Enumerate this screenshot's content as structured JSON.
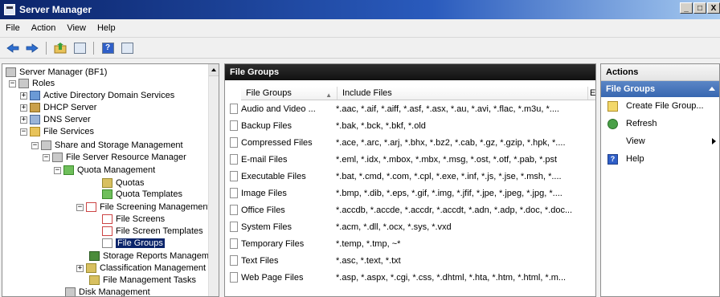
{
  "window": {
    "title": "Server Manager",
    "buttons": [
      "_",
      "□",
      "X"
    ]
  },
  "menu": [
    "File",
    "Action",
    "View",
    "Help"
  ],
  "toolbar": {
    "buttons": [
      "back-arrow-icon",
      "forward-arrow-icon",
      "up-folder-icon",
      "show-hide-tree-icon",
      "help-icon",
      "properties-icon"
    ],
    "help_glyph": "?"
  },
  "tree": {
    "nodes": [
      {
        "label": "Server Manager (BF1)",
        "expander": "",
        "icon": "server-manager-icon"
      },
      {
        "label": "Roles",
        "expander": "−",
        "icon": "roles-icon"
      },
      {
        "label": "Active Directory Domain Services",
        "expander": "+",
        "icon": "active-directory-icon"
      },
      {
        "label": "DHCP Server",
        "expander": "+",
        "icon": "dhcp-icon"
      },
      {
        "label": "DNS Server",
        "expander": "+",
        "icon": "dns-icon"
      },
      {
        "label": "File Services",
        "expander": "−",
        "icon": "file-services-icon"
      },
      {
        "label": "Share and Storage Management",
        "expander": "−",
        "icon": "share-storage-icon"
      },
      {
        "label": "File Server Resource Manager",
        "expander": "−",
        "icon": "fsrm-icon"
      },
      {
        "label": "Quota Management",
        "expander": "−",
        "icon": "quota-management-icon"
      },
      {
        "label": "Quotas",
        "expander": "",
        "icon": "quotas-icon"
      },
      {
        "label": "Quota Templates",
        "expander": "",
        "icon": "quota-templates-icon"
      },
      {
        "label": "File Screening Management",
        "expander": "−",
        "icon": "file-screening-icon"
      },
      {
        "label": "File Screens",
        "expander": "",
        "icon": "file-screens-icon"
      },
      {
        "label": "File Screen Templates",
        "expander": "",
        "icon": "file-screen-templates-icon"
      },
      {
        "label": "File Groups",
        "expander": "",
        "icon": "file-groups-icon"
      },
      {
        "label": "Storage Reports Managemer",
        "expander": "",
        "icon": "storage-reports-icon"
      },
      {
        "label": "Classification Management",
        "expander": "+",
        "icon": "classification-icon"
      },
      {
        "label": "File Management Tasks",
        "expander": "",
        "icon": "file-management-tasks-icon"
      },
      {
        "label": "Disk Management",
        "expander": "",
        "icon": "disk-management-icon"
      }
    ]
  },
  "center": {
    "title": "File Groups",
    "columns": [
      "File Groups",
      "Include Files",
      "E."
    ],
    "rows": [
      {
        "name": "Audio and Video ...",
        "include": "*.aac, *.aif, *.aiff, *.asf, *.asx, *.au, *.avi, *.flac, *.m3u, *...."
      },
      {
        "name": "Backup Files",
        "include": "*.bak, *.bck, *.bkf, *.old"
      },
      {
        "name": "Compressed Files",
        "include": "*.ace, *.arc, *.arj, *.bhx, *.bz2, *.cab, *.gz, *.gzip, *.hpk, *...."
      },
      {
        "name": "E-mail Files",
        "include": "*.eml, *.idx, *.mbox, *.mbx, *.msg, *.ost, *.otf, *.pab, *.pst"
      },
      {
        "name": "Executable Files",
        "include": "*.bat, *.cmd, *.com, *.cpl, *.exe, *.inf, *.js, *.jse, *.msh, *...."
      },
      {
        "name": "Image Files",
        "include": "*.bmp, *.dib, *.eps, *.gif, *.img, *.jfif, *.jpe, *.jpeg, *.jpg, *...."
      },
      {
        "name": "Office Files",
        "include": "*.accdb, *.accde, *.accdr, *.accdt, *.adn, *.adp, *.doc, *.doc..."
      },
      {
        "name": "System Files",
        "include": "*.acm, *.dll, *.ocx, *.sys, *.vxd"
      },
      {
        "name": "Temporary Files",
        "include": "*.temp, *.tmp, ~*"
      },
      {
        "name": "Text Files",
        "include": "*.asc, *.text, *.txt"
      },
      {
        "name": "Web Page Files",
        "include": "*.asp, *.aspx, *.cgi, *.css, *.dhtml, *.hta, *.htm, *.html, *.m..."
      }
    ]
  },
  "actions": {
    "title": "Actions",
    "section": "File Groups",
    "items": [
      {
        "label": "Create File Group...",
        "icon": "create-file-group-icon"
      },
      {
        "label": "Refresh",
        "icon": "refresh-icon"
      },
      {
        "label": "View",
        "icon": ""
      },
      {
        "label": "Help",
        "icon": "help-icon"
      }
    ]
  }
}
